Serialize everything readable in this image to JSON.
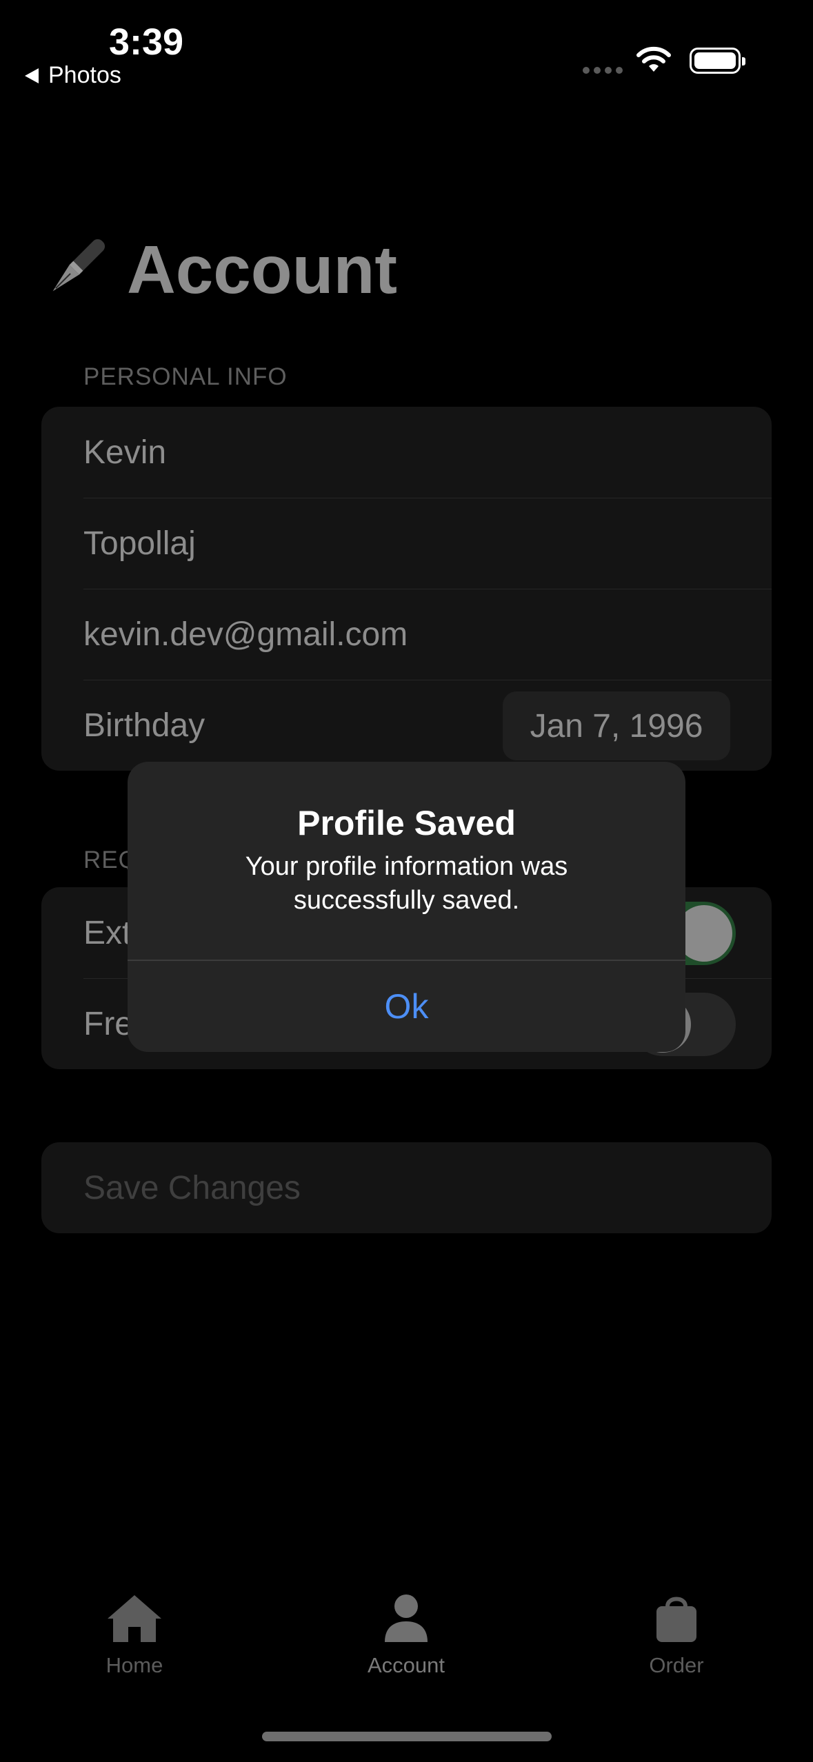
{
  "status_bar": {
    "time": "3:39",
    "back_label": "Photos"
  },
  "page": {
    "title": "Account"
  },
  "personal_info": {
    "section_label": "PERSONAL INFO",
    "first_name": "Kevin",
    "last_name": "Topollaj",
    "email": "kevin.dev@gmail.com",
    "birthday_label": "Birthday",
    "birthday_value": "Jan 7, 1996"
  },
  "requests": {
    "section_label_visible": "REQ",
    "rows": [
      {
        "label_visible": "Ext",
        "toggle_on": true
      },
      {
        "label_visible": "Fre",
        "toggle_on": false
      }
    ]
  },
  "save_button": {
    "label": "Save Changes"
  },
  "tabs": [
    {
      "label": "Home",
      "icon": "house-icon"
    },
    {
      "label": "Account",
      "icon": "person-icon"
    },
    {
      "label": "Order",
      "icon": "bag-icon"
    }
  ],
  "alert": {
    "title": "Profile Saved",
    "message": "Your profile information was successfully saved.",
    "button": "Ok"
  },
  "colors": {
    "accent": "#4d8ff6",
    "toggle_on": "#2f9e44"
  }
}
